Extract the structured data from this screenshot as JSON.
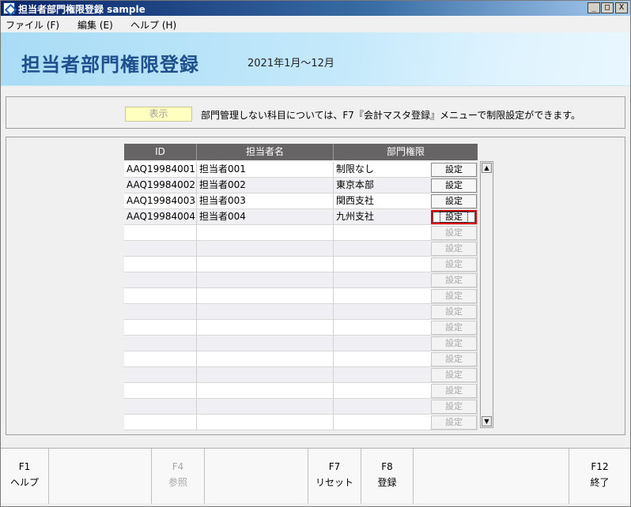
{
  "window": {
    "title": "担当者部門権限登録 sample",
    "controls": {
      "minimize": "_",
      "maximize": "□",
      "close": "X"
    }
  },
  "menu": [
    {
      "label": "ファイル (F)"
    },
    {
      "label": "編集 (E)"
    },
    {
      "label": "ヘルプ (H)"
    }
  ],
  "header": {
    "title": "担当者部門権限登録",
    "period": "2021年1月～12月"
  },
  "info": {
    "show_button": "表示",
    "message": "部門管理しない科目については、F7『会計マスタ登録』メニューで制限設定ができます。"
  },
  "grid": {
    "columns": [
      "ID",
      "担当者名",
      "部門権限"
    ],
    "setting_label": "設定",
    "rows": [
      {
        "id": "AAQ19984001",
        "name": "担当者001",
        "dept": "制限なし",
        "enabled": true
      },
      {
        "id": "AAQ19984002",
        "name": "担当者002",
        "dept": "東京本部",
        "enabled": true
      },
      {
        "id": "AAQ19984003",
        "name": "担当者003",
        "dept": "関西支社",
        "enabled": true
      },
      {
        "id": "AAQ19984004",
        "name": "担当者004",
        "dept": "九州支社",
        "enabled": true,
        "focused": true
      },
      {
        "id": "",
        "name": "",
        "dept": "",
        "enabled": false
      },
      {
        "id": "",
        "name": "",
        "dept": "",
        "enabled": false
      },
      {
        "id": "",
        "name": "",
        "dept": "",
        "enabled": false
      },
      {
        "id": "",
        "name": "",
        "dept": "",
        "enabled": false
      },
      {
        "id": "",
        "name": "",
        "dept": "",
        "enabled": false
      },
      {
        "id": "",
        "name": "",
        "dept": "",
        "enabled": false
      },
      {
        "id": "",
        "name": "",
        "dept": "",
        "enabled": false
      },
      {
        "id": "",
        "name": "",
        "dept": "",
        "enabled": false
      },
      {
        "id": "",
        "name": "",
        "dept": "",
        "enabled": false
      },
      {
        "id": "",
        "name": "",
        "dept": "",
        "enabled": false
      },
      {
        "id": "",
        "name": "",
        "dept": "",
        "enabled": false
      },
      {
        "id": "",
        "name": "",
        "dept": "",
        "enabled": false
      },
      {
        "id": "",
        "name": "",
        "dept": "",
        "enabled": false
      }
    ]
  },
  "fkeys": [
    {
      "key": "F1",
      "label": "ヘルプ",
      "enabled": true
    },
    {
      "key": "",
      "label": "",
      "enabled": false
    },
    {
      "key": "F4",
      "label": "参照",
      "enabled": false
    },
    {
      "key": "",
      "label": "",
      "enabled": false
    },
    {
      "key": "F7",
      "label": "リセット",
      "enabled": true
    },
    {
      "key": "F8",
      "label": "登録",
      "enabled": true
    },
    {
      "key": "",
      "label": "",
      "enabled": false
    },
    {
      "key": "F12",
      "label": "終了",
      "enabled": true
    }
  ],
  "colors": {
    "title_accent": "#1f4f8c",
    "grid_header": "#666464",
    "show_button_bg": "#ffffc0",
    "focus_outline": "#e00000"
  }
}
